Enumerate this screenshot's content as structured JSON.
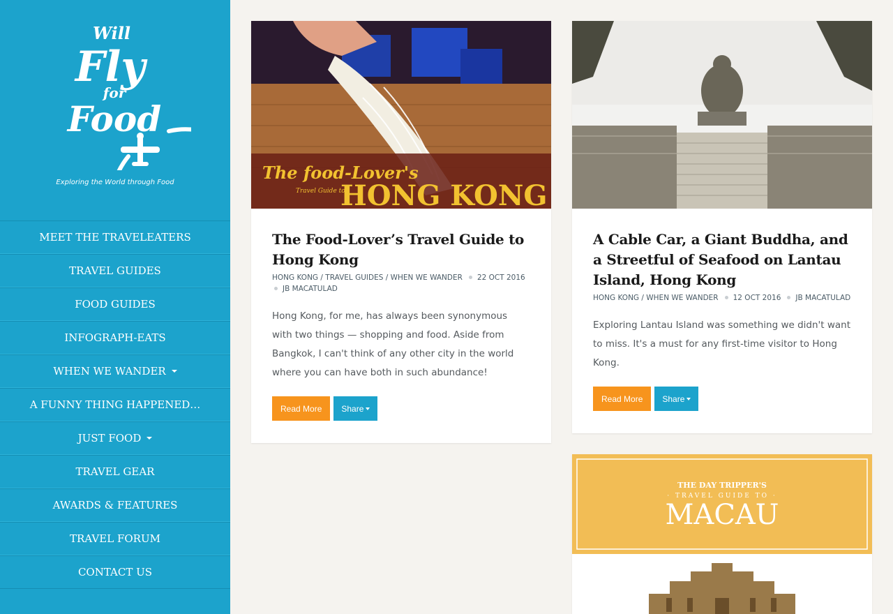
{
  "site": {
    "logo_text": [
      "Will",
      "Fly",
      "for",
      "Food"
    ],
    "tagline": "Exploring the World through Food",
    "brand_color": "#1ca3cc",
    "accent_color": "#f7941d"
  },
  "nav": [
    {
      "label": "MEET THE TRAVELEATERS",
      "dropdown": false
    },
    {
      "label": "TRAVEL GUIDES",
      "dropdown": false
    },
    {
      "label": "FOOD GUIDES",
      "dropdown": false
    },
    {
      "label": "INFOGRAPH-EATS",
      "dropdown": false
    },
    {
      "label": "WHEN WE WANDER",
      "dropdown": true
    },
    {
      "label": "A FUNNY THING HAPPENED…",
      "dropdown": false
    },
    {
      "label": "JUST FOOD",
      "dropdown": true
    },
    {
      "label": "TRAVEL GEAR",
      "dropdown": false
    },
    {
      "label": "AWARDS & FEATURES",
      "dropdown": false
    },
    {
      "label": "TRAVEL FORUM",
      "dropdown": false
    },
    {
      "label": "CONTACT US",
      "dropdown": false
    }
  ],
  "posts": [
    {
      "image_text": {
        "line1": "The food-Lover's",
        "line2": "Travel Guide to",
        "line3": "HONG KONG"
      },
      "title": "The Food-Lover’s Travel Guide to Hong Kong",
      "categories": [
        "HONG KONG",
        "TRAVEL GUIDES",
        "WHEN WE WANDER"
      ],
      "date": "22 OCT 2016",
      "author": "JB MACATULAD",
      "excerpt": "Hong Kong, for me, has always been synonymous with two things — shopping and food. Aside from Bangkok, I can't think of any other city in the world where you can have both in such abundance!",
      "read_more": "Read More",
      "share": "Share"
    },
    {
      "title": "A Cable Car, a Giant Buddha, and a Streetful of Seafood on Lantau Island, Hong Kong",
      "categories": [
        "HONG KONG",
        "WHEN WE WANDER"
      ],
      "date": "12 OCT 2016",
      "author": "JB MACATULAD",
      "excerpt": "Exploring Lantau Island was something we didn't want to miss. It's a must for any first-time visitor to Hong Kong.",
      "read_more": "Read More",
      "share": "Share"
    },
    {
      "image_text": {
        "line1": "THE DAY TRIPPER'S",
        "line2": "· TRAVEL GUIDE TO ·",
        "line3": "MACAU"
      }
    }
  ]
}
